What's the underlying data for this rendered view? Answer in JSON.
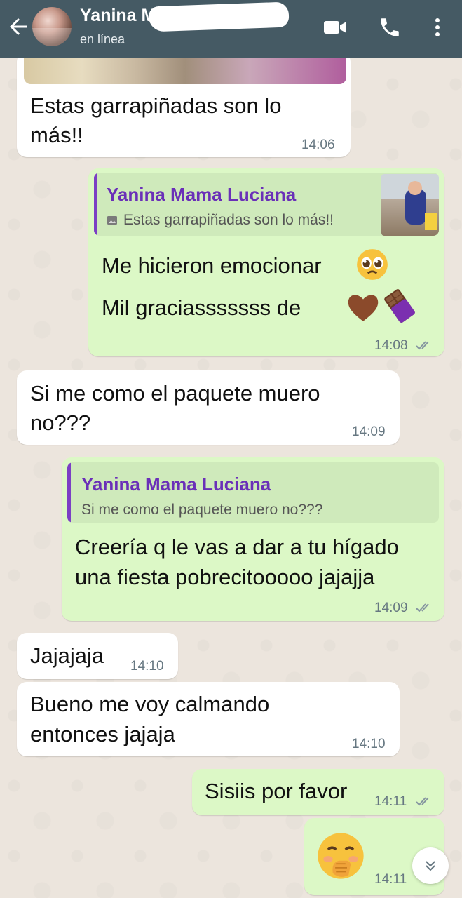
{
  "header": {
    "contact_name": "Yanina M",
    "status": "en línea",
    "icons": [
      "back-arrow-icon",
      "video-call-icon",
      "voice-call-icon",
      "more-options-icon"
    ]
  },
  "messages": [
    {
      "direction": "incoming",
      "text_lines": [
        "Estas garrapiñadas son lo",
        "más!!"
      ],
      "time": "14:06",
      "has_photo": true
    },
    {
      "direction": "outgoing",
      "quote": {
        "author": "Yanina Mama Luciana",
        "text": "Estas garrapiñadas son lo más!!",
        "icon": "photo-icon"
      },
      "text_lines": [
        "Me hicieron emocionar",
        "Mil graciasssssss de"
      ],
      "emojis": [
        "pleading-face-emoji",
        "brown-heart-emoji",
        "chocolate-bar-emoji"
      ],
      "time": "14:08",
      "read": true
    },
    {
      "direction": "incoming",
      "text_lines": [
        "Si me como el paquete muero",
        "no???"
      ],
      "time": "14:09"
    },
    {
      "direction": "outgoing",
      "quote": {
        "author": "Yanina Mama Luciana",
        "text": "Si me como el paquete muero no???"
      },
      "text_lines": [
        "Creería q le vas a dar a tu hígado",
        "una fiesta pobrecitooooo jajajja"
      ],
      "time": "14:09",
      "read": true
    },
    {
      "direction": "incoming",
      "text_lines": [
        "Jajajaja"
      ],
      "time": "14:10"
    },
    {
      "direction": "incoming",
      "text_lines": [
        "Bueno me voy calmando",
        "entonces jajaja"
      ],
      "time": "14:10"
    },
    {
      "direction": "outgoing",
      "text_lines": [
        "Sisiis por favor"
      ],
      "time": "14:11",
      "read": true
    },
    {
      "direction": "outgoing",
      "emojis": [
        "face-with-hand-over-mouth-emoji"
      ],
      "time": "14:11",
      "read": true
    }
  ],
  "colors": {
    "header_bg": "#455a64",
    "incoming_bubble": "#ffffff",
    "outgoing_bubble": "#dcf8c6",
    "quote_accent": "#7b3fc4",
    "timestamp": "#667781"
  }
}
